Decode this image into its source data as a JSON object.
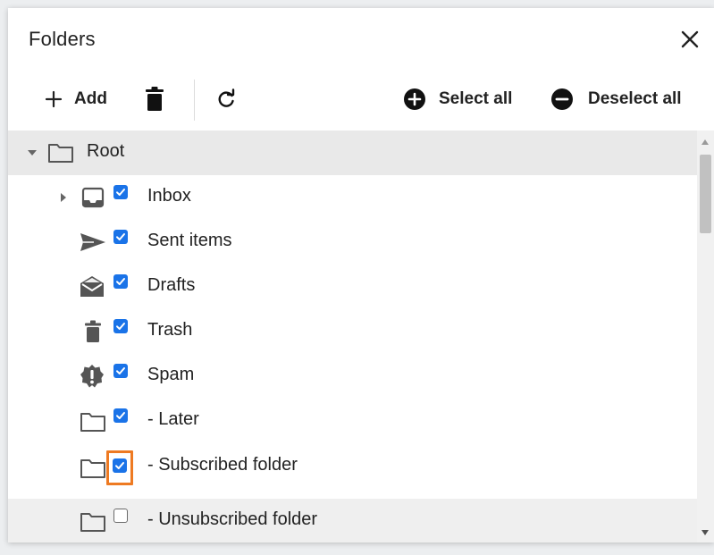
{
  "dialog": {
    "title": "Folders",
    "close_icon": "close-icon"
  },
  "toolbar": {
    "add_label": "Add",
    "delete_icon": "trash-icon",
    "refresh_icon": "refresh-icon",
    "select_all_label": "Select all",
    "deselect_all_label": "Deselect all"
  },
  "tree": {
    "root": {
      "label": "Root",
      "icon": "folder-icon",
      "expanded": true
    },
    "items": [
      {
        "label": "Inbox",
        "icon": "inbox-icon",
        "checked": true,
        "expandable": true
      },
      {
        "label": "Sent items",
        "icon": "send-icon",
        "checked": true
      },
      {
        "label": "Drafts",
        "icon": "drafts-envelope-icon",
        "checked": true
      },
      {
        "label": "Trash",
        "icon": "trash-icon",
        "checked": true
      },
      {
        "label": "Spam",
        "icon": "spam-icon",
        "checked": true
      },
      {
        "label": "- Later",
        "icon": "folder-icon",
        "checked": true
      },
      {
        "label": "- Subscribed folder",
        "icon": "folder-icon",
        "checked": true,
        "focused": true
      },
      {
        "label": "- Unsubscribed folder",
        "icon": "folder-icon",
        "checked": false,
        "hovered": true
      }
    ]
  },
  "colors": {
    "checkbox_checked": "#1a73e8",
    "focus_ring": "#ee7a22",
    "root_row_bg": "#e9e9e9",
    "icon_gray": "#555555"
  }
}
